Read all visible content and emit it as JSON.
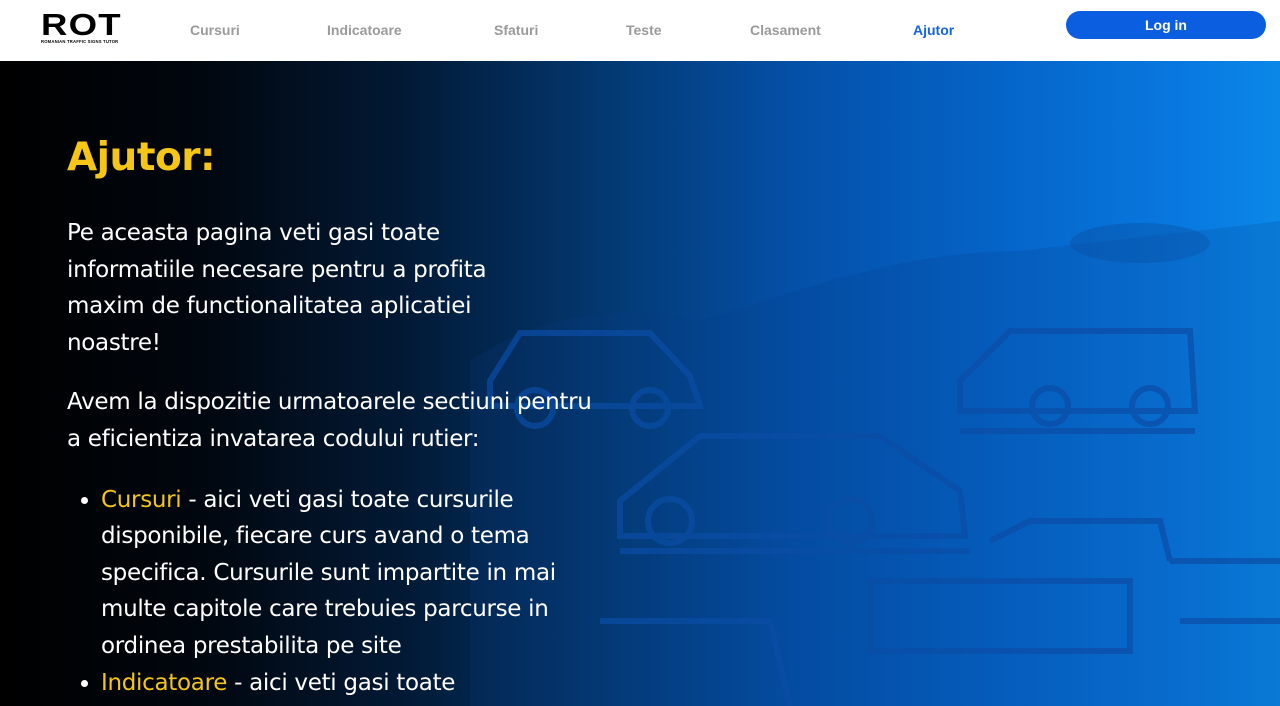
{
  "header": {
    "logo_text": "ROT",
    "logo_tagline": "ROMANIAN TRAFFIC SIGNS TUTOR",
    "nav": [
      {
        "label": "Cursuri"
      },
      {
        "label": "Indicatoare"
      },
      {
        "label": "Sfaturi"
      },
      {
        "label": "Teste"
      },
      {
        "label": "Clasament"
      },
      {
        "label": "Ajutor"
      }
    ],
    "active_nav": "Ajutor",
    "login_label": "Log in"
  },
  "main": {
    "heading": "Ajutor:",
    "intro": "Pe aceasta pagina veti gasi toate informatiile necesare pentru a profita maxim de functionalitatea aplicatiei noastre!",
    "sections_intro": "Avem la dispozitie urmatoarele sectiuni pentru a eficientiza invatarea codului rutier:",
    "sections": [
      {
        "name": "Cursuri",
        "description": " - aici veti gasi toate cursurile disponibile, fiecare curs avand o tema specifica. Cursurile sunt impartite in mai multe capitole care trebuies parcurse in ordinea prestabilita pe site"
      },
      {
        "name": "Indicatoare",
        "description": " - aici veti gasi toate"
      }
    ]
  },
  "colors": {
    "accent_yellow": "#f5c518",
    "brand_blue": "#0c5ee0",
    "nav_inactive": "#9a9a9a"
  }
}
